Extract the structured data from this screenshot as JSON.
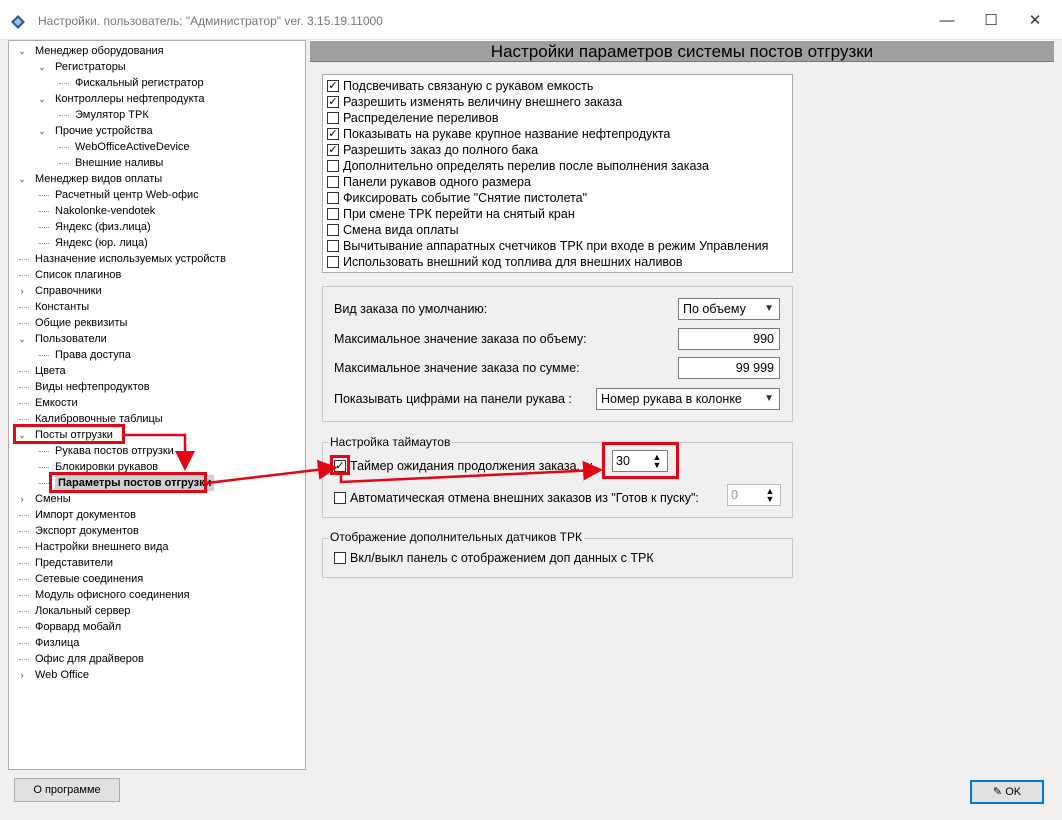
{
  "window": {
    "title": "Настройки. пользователь: \"Администратор\" ver. 3.15.19.11000",
    "min": "—",
    "max": "☐",
    "close": "✕"
  },
  "tree": [
    {
      "label": "Менеджер оборудования",
      "exp": "v"
    },
    {
      "label": "Регистраторы",
      "exp": "v"
    },
    {
      "label": "Фискальный регистратор",
      "exp": ""
    },
    {
      "label": "Контроллеры нефтепродукта",
      "exp": "v"
    },
    {
      "label": "Эмулятор ТРК",
      "exp": ""
    },
    {
      "label": "Прочие устройства",
      "exp": "v"
    },
    {
      "label": "WebOfficeActiveDevice",
      "exp": ""
    },
    {
      "label": "Внешние наливы",
      "exp": ""
    },
    {
      "label": "Менеджер видов оплаты",
      "exp": "v"
    },
    {
      "label": "Расчетный центр Web-офис",
      "exp": ""
    },
    {
      "label": "Nakolonke-vendotek",
      "exp": ""
    },
    {
      "label": "Яндекс (физ.лица)",
      "exp": ""
    },
    {
      "label": "Яндекс (юр. лица)",
      "exp": ""
    },
    {
      "label": "Назначение используемых устройств",
      "exp": ""
    },
    {
      "label": "Список плагинов",
      "exp": ""
    },
    {
      "label": "Справочники",
      "exp": ">"
    },
    {
      "label": "Константы",
      "exp": ""
    },
    {
      "label": "Общие реквизиты",
      "exp": ""
    },
    {
      "label": "Пользователи",
      "exp": "v"
    },
    {
      "label": "Права доступа",
      "exp": ""
    },
    {
      "label": "Цвета",
      "exp": ""
    },
    {
      "label": "Виды нефтепродуктов",
      "exp": ""
    },
    {
      "label": "Емкости",
      "exp": ""
    },
    {
      "label": "Калибровочные таблицы",
      "exp": ""
    },
    {
      "label": "Посты отгрузки",
      "exp": "v"
    },
    {
      "label": "Рукава постов отгрузки",
      "exp": ""
    },
    {
      "label": "Блокировки рукавов",
      "exp": ""
    },
    {
      "label": "Параметры постов отгрузки",
      "exp": ""
    },
    {
      "label": "Смены",
      "exp": ">"
    },
    {
      "label": "Импорт документов",
      "exp": ""
    },
    {
      "label": "Экспорт документов",
      "exp": ""
    },
    {
      "label": "Настройки внешнего вида",
      "exp": ""
    },
    {
      "label": "Представители",
      "exp": ""
    },
    {
      "label": "Сетевые соединения",
      "exp": ""
    },
    {
      "label": "Модуль офисного соединения",
      "exp": ""
    },
    {
      "label": "Локальный сервер",
      "exp": ""
    },
    {
      "label": "Форвард мобайл",
      "exp": ""
    },
    {
      "label": "Физлица",
      "exp": ""
    },
    {
      "label": "Офис для драйверов",
      "exp": ""
    },
    {
      "label": "Web Office",
      "exp": ">"
    }
  ],
  "header": "Настройки параметров системы постов отгрузки",
  "checkboxes": [
    {
      "label": "Подсвечивать связаную с рукавом емкость",
      "checked": "✓"
    },
    {
      "label": "Разрешить изменять величину внешнего заказа",
      "checked": "✓"
    },
    {
      "label": "Распределение переливов",
      "checked": ""
    },
    {
      "label": "Показывать на рукаве крупное название нефтепродукта",
      "checked": "✓"
    },
    {
      "label": "Разрешить заказ до полного бака",
      "checked": "✓"
    },
    {
      "label": "Дополнительно определять перелив после выполнения заказа",
      "checked": ""
    },
    {
      "label": "Панели рукавов одного размера",
      "checked": ""
    },
    {
      "label": "Фиксировать событие \"Снятие пистолета\"",
      "checked": ""
    },
    {
      "label": "При смене ТРК перейти на снятый кран",
      "checked": ""
    },
    {
      "label": "Смена вида оплаты",
      "checked": ""
    },
    {
      "label": "Вычитывание аппаратных счетчиков ТРК при входе в режим Управления",
      "checked": ""
    },
    {
      "label": "Использовать внешний код топлива для внешних наливов",
      "checked": ""
    }
  ],
  "order": {
    "type_label": "Вид заказа по умолчанию:",
    "type_value": "По объему",
    "max_volume_label": "Максимальное значение заказа по объему:",
    "max_volume_value": "990",
    "max_sum_label": "Максимальное значение заказа по сумме:",
    "max_sum_value": "99 999",
    "digits_label": "Показывать цифрами на панели рукава :",
    "digits_value": "Номер рукава в колонке"
  },
  "timeouts": {
    "title": "Настройка таймаутов",
    "timer_label": "Таймер ожидания продолжения заказа, с:",
    "timer_checked": "✓",
    "timer_value": "30",
    "auto_cancel_label": "Автоматическая отмена внешних заказов из \"Готов к пуску\":",
    "auto_cancel_checked": "",
    "auto_cancel_value": "0"
  },
  "sensors": {
    "title": "Отображение дополнительных датчиков ТРК",
    "panel_label": "Вкл/выкл панель с отображением доп данных с ТРК",
    "panel_checked": ""
  },
  "buttons": {
    "about": "О программе",
    "ok": "OK"
  },
  "colors": {
    "highlight": "#e30613",
    "header": "#a0a0a0",
    "selected": "#cfcfcf"
  }
}
